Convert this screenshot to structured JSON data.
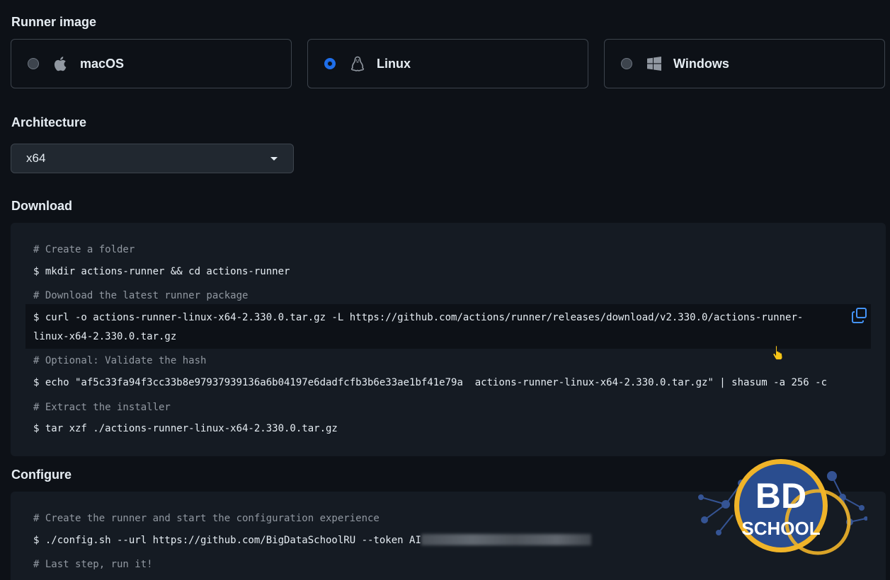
{
  "runner_image": {
    "title": "Runner image",
    "options": [
      {
        "label": "macOS",
        "icon": "apple-icon",
        "selected": false
      },
      {
        "label": "Linux",
        "icon": "linux-tux-icon",
        "selected": true
      },
      {
        "label": "Windows",
        "icon": "windows-icon",
        "selected": false
      }
    ]
  },
  "architecture": {
    "title": "Architecture",
    "selected": "x64"
  },
  "download": {
    "title": "Download",
    "lines": [
      {
        "type": "comment",
        "text": "# Create a folder"
      },
      {
        "type": "command",
        "text": "$ mkdir actions-runner && cd actions-runner"
      },
      {
        "type": "comment",
        "text": "# Download the latest runner package"
      },
      {
        "type": "command",
        "text": "$ curl -o actions-runner-linux-x64-2.330.0.tar.gz -L https://github.com/actions/runner/releases/download/v2.330.0/actions-runner-"
      },
      {
        "type": "command",
        "text": "linux-x64-2.330.0.tar.gz"
      },
      {
        "type": "comment",
        "text": "# Optional: Validate the hash"
      },
      {
        "type": "command",
        "text": "$ echo \"af5c33fa94f3cc33b8e97937939136a6b04197e6dadfcfb3b6e33ae1bf41e79a  actions-runner-linux-x64-2.330.0.tar.gz\" | shasum -a 256 -c"
      },
      {
        "type": "comment",
        "text": "# Extract the installer"
      },
      {
        "type": "command",
        "text": "$ tar xzf ./actions-runner-linux-x64-2.330.0.tar.gz"
      }
    ]
  },
  "configure": {
    "title": "Configure",
    "lines": [
      {
        "type": "comment",
        "text": "# Create the runner and start the configuration experience"
      },
      {
        "type": "command",
        "text": "$ ./config.sh --url https://github.com/BigDataSchoolRU --token AI"
      },
      {
        "type": "comment",
        "text": "# Last step, run it!"
      }
    ]
  },
  "watermark": {
    "line1": "BD",
    "line2": "SCHOOL"
  },
  "colors": {
    "background": "#0d1117",
    "code_bg": "#151b23",
    "accent": "#1f6feb",
    "logo_ring": "#f0b429",
    "logo_fill": "#2a4d8f"
  }
}
